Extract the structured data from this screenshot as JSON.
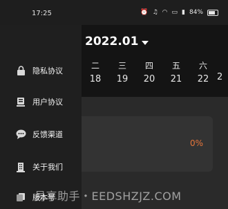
{
  "status_bar": {
    "time": "17:25",
    "icons": [
      "alarm-icon",
      "mute-icon",
      "wifi-icon",
      "sim-icon",
      "signal-icon"
    ],
    "battery_text": "84%"
  },
  "drawer": {
    "items": [
      {
        "label": "隐私协议",
        "icon": "lock-icon"
      },
      {
        "label": "用户协议",
        "icon": "document-icon"
      },
      {
        "label": "反馈渠道",
        "icon": "chat-icon"
      },
      {
        "label": "关于我们",
        "icon": "building-icon"
      },
      {
        "label": "版本号",
        "icon": "copy-icon"
      }
    ]
  },
  "calendar": {
    "month": "2022.01",
    "days": [
      {
        "weekday": "二",
        "date": "18"
      },
      {
        "weekday": "三",
        "date": "19"
      },
      {
        "weekday": "四",
        "date": "20"
      },
      {
        "weekday": "五",
        "date": "21"
      },
      {
        "weekday": "六",
        "date": "22"
      },
      {
        "weekday": "",
        "date": "2"
      }
    ]
  },
  "progress": {
    "text": "0%",
    "accent": "#e8763b"
  },
  "watermark": "易享助手・EEDSHZJZ.COM"
}
